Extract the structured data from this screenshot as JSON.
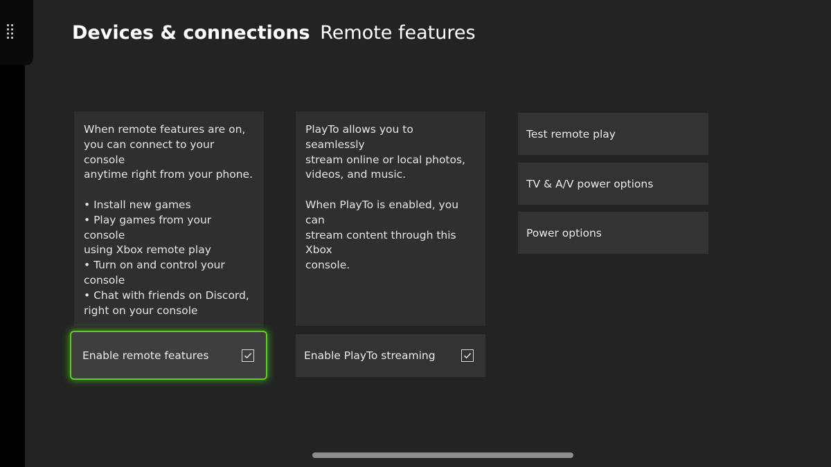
{
  "header": {
    "section": "Devices & connections",
    "page": "Remote features"
  },
  "remote_features": {
    "description": "When remote features are on,\nyou can connect to your console\nanytime right from your phone.\n\n• Install new games\n• Play games from your console\nusing Xbox remote play\n• Turn on and control your\nconsole\n• Chat with friends on Discord,\nright on your console",
    "toggle_label": "Enable remote features",
    "checked": true
  },
  "playto": {
    "description": "PlayTo allows you to seamlessly\nstream online or local photos,\nvideos, and music.\n\nWhen PlayTo is enabled, you can\nstream content through this Xbox\nconsole.",
    "toggle_label": "Enable PlayTo streaming",
    "checked": true
  },
  "menu": {
    "items": [
      {
        "label": "Test remote play"
      },
      {
        "label": "TV & A/V power options"
      },
      {
        "label": "Power options"
      }
    ]
  },
  "colors": {
    "background": "#232323",
    "focus": "#59d41e",
    "card": "#2f2f2f"
  },
  "icons": [
    "drag-handle-icon",
    "checkbox-checked-icon"
  ]
}
